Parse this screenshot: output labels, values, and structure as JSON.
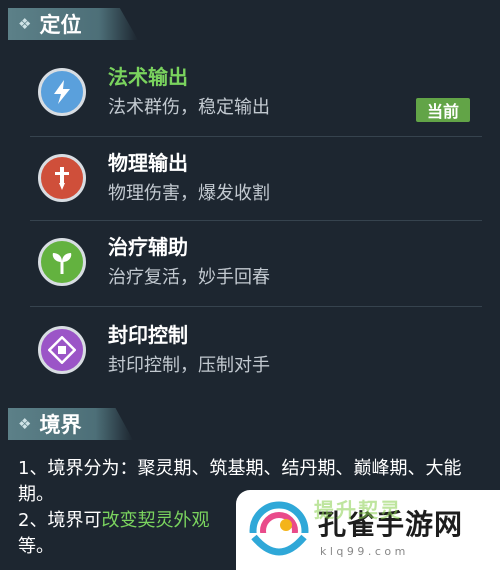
{
  "sections": {
    "position": {
      "title": "定位"
    },
    "realm": {
      "title": "境界"
    }
  },
  "roles": [
    {
      "name": "法术输出",
      "desc": "法术群伤，稳定输出",
      "icon": "lightning-icon",
      "color": "#5aa0dc",
      "active": true
    },
    {
      "name": "物理输出",
      "desc": "物理伤害，爆发收割",
      "icon": "sword-icon",
      "color": "#cf4f3a"
    },
    {
      "name": "治疗辅助",
      "desc": "治疗复活，妙手回春",
      "icon": "sprout-icon",
      "color": "#63b23f"
    },
    {
      "name": "封印控制",
      "desc": "封印控制，压制对手",
      "icon": "seal-icon",
      "color": "#9b55c7"
    }
  ],
  "current_badge": "当前",
  "realm": {
    "line1": "1、境界分为：聚灵期、筑基期、结丹期、巅峰期、大能期。",
    "line2_prefix": "2、境界可",
    "line2_highlight": "改变契灵外观",
    "line3": "等。"
  },
  "watermark": {
    "name": "孔雀手游网",
    "url": "k l q 9 9 . c o m",
    "faded_top": "提升契灵"
  },
  "colors": {
    "background": "#1d2630",
    "active_green": "#7ad35e",
    "badge_green": "#62a447"
  }
}
